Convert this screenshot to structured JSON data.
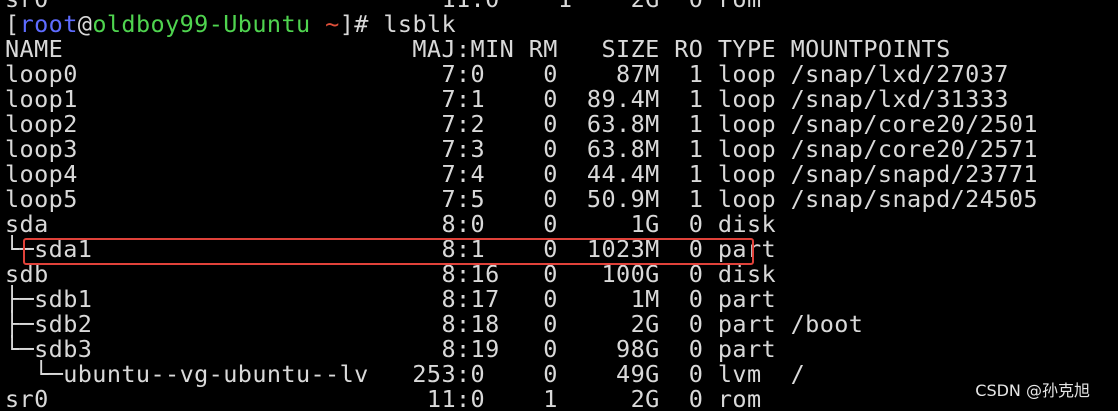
{
  "terminal": {
    "partial_top_line": "sr0                           11:0    1    2G  0 rom",
    "prompt": {
      "open": "[",
      "user": "root",
      "at": "@",
      "host": "oldboy99-Ubuntu",
      "space": " ",
      "cwd": "~",
      "close": "]# ",
      "command": "lsblk"
    },
    "header": "NAME                        MAJ:MIN RM   SIZE RO TYPE MOUNTPOINTS",
    "rows": [
      "loop0                         7:0    0    87M  1 loop /snap/lxd/27037",
      "loop1                         7:1    0  89.4M  1 loop /snap/lxd/31333",
      "loop2                         7:2    0  63.8M  1 loop /snap/core20/2501",
      "loop3                         7:3    0  63.8M  1 loop /snap/core20/2571",
      "loop4                         7:4    0  44.4M  1 loop /snap/snapd/23771",
      "loop5                         7:5    0  50.9M  1 loop /snap/snapd/24505",
      "sda                           8:0    0     1G  0 disk",
      "└─sda1                        8:1    0  1023M  0 part",
      "sdb                           8:16   0   100G  0 disk",
      "├─sdb1                        8:17   0     1M  0 part",
      "├─sdb2                        8:18   0     2G  0 part /boot",
      "└─sdb3                        8:19   0    98G  0 part",
      "  └─ubuntu--vg-ubuntu--lv   253:0    0    49G  0 lvm  /",
      "sr0                          11:0    1     2G  0 rom"
    ]
  },
  "watermark": "CSDN @孙克旭",
  "colors": {
    "background": "#000000",
    "text": "#d9d9d9",
    "prompt_user": "#5e6cff",
    "prompt_host": "#4fd44f",
    "prompt_cwd": "#e0503a",
    "highlight_box": "#e0423a"
  }
}
